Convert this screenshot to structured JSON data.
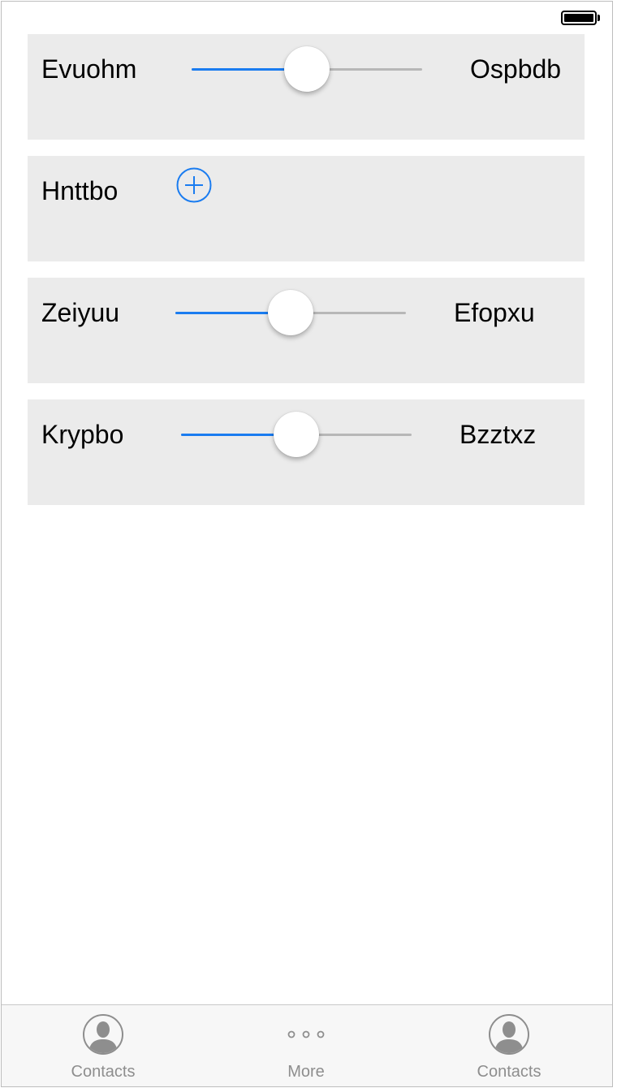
{
  "rows": [
    {
      "type": "slider",
      "label": "Evuohm",
      "value_label": "Ospbdb",
      "slider_value": 0.5
    },
    {
      "type": "add",
      "label": "Hnttbo"
    },
    {
      "type": "slider",
      "label": "Zeiyuu",
      "value_label": "Efopxu",
      "slider_value": 0.5
    },
    {
      "type": "slider",
      "label": "Krypbo",
      "value_label": "Bzztxz",
      "slider_value": 0.5
    }
  ],
  "tabs": [
    {
      "label": "Contacts",
      "icon": "person-icon"
    },
    {
      "label": "More",
      "icon": "more-icon"
    },
    {
      "label": "Contacts",
      "icon": "person-icon"
    }
  ],
  "colors": {
    "accent": "#1a7cf0",
    "track": "#b7b7b7",
    "card_background": "#ebebeb",
    "tab_label": "#8e8e8e"
  }
}
